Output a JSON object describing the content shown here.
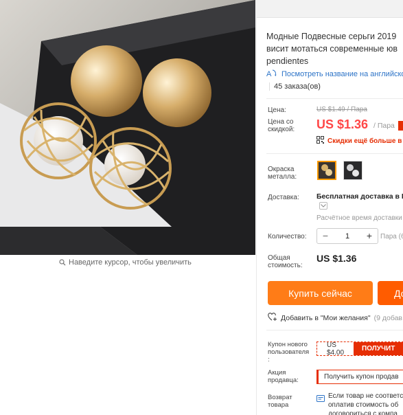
{
  "gallery": {
    "zoom_hint": "Наведите курсор, чтобы увеличить"
  },
  "product": {
    "title_lines": [
      "Модные Подвесные серьги 2019",
      "висит мотаться современные юв",
      "pendientes"
    ],
    "translate_link": "Посмотреть название на английском",
    "orders": "45 заказа(ов)"
  },
  "pricing": {
    "price_label": "Цена:",
    "old_price": "US $1.49 / Пара",
    "discount_label_lines": [
      "Цена со",
      "скидкой:"
    ],
    "price": "US $1.36",
    "per_unit": "/ Пара",
    "cheaper_text": "Скидки ещё больше в п"
  },
  "options": {
    "color_label_lines": [
      "Окраска",
      "металла:"
    ]
  },
  "delivery": {
    "label": "Доставка:",
    "method": "Бесплатная доставка в R",
    "estimate": "Расчётное время доставки"
  },
  "quantity": {
    "label": "Количество:",
    "minus": "−",
    "value": "1",
    "plus": "+",
    "available": "Пара (6"
  },
  "total": {
    "label_lines": [
      "Общая",
      "стоимость:"
    ],
    "value": "US $1.36"
  },
  "actions": {
    "buy_now": "Купить сейчас",
    "add_to_cart": "До",
    "wishlist": "Добавить в \"Мои желания\"",
    "wishlist_count": "(9 добав"
  },
  "coupon": {
    "label_lines": [
      "Купон нового",
      "пользователя",
      ":"
    ],
    "amount": "US $4.00",
    "get": "ПОЛУЧИТ"
  },
  "seller_promo": {
    "label_lines": [
      "Акция",
      "продавца:"
    ],
    "text": "Получить купон продав"
  },
  "returns": {
    "label_lines": [
      "Возврат",
      "товара"
    ],
    "text_lines": [
      "Если товар не соответс",
      "оплатив стоимость об",
      "договориться с компа"
    ]
  },
  "colors": {
    "price_red": "#ff4747",
    "buy_orange": "#ff7c17",
    "cart_orange": "#ff5c00",
    "link_blue": "#2c73c7"
  }
}
